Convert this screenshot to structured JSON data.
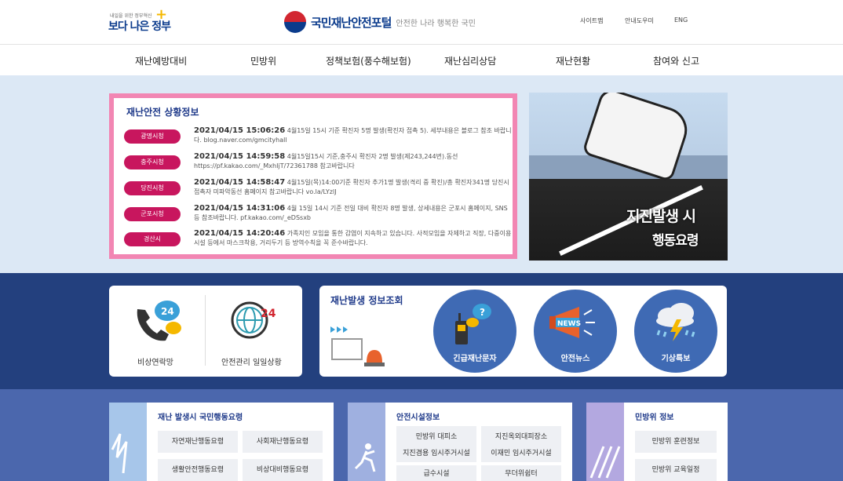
{
  "header": {
    "gov_logo_small": "내일을 위한 정부혁신",
    "gov_logo_big": "보다 나은 정부",
    "portal_name": "국민재난안전포털",
    "portal_slogan": "안전한 나라 행복한 국민",
    "util": [
      "사이트맵",
      "안내도우미",
      "ENG"
    ]
  },
  "gnb": [
    "재난예방대비",
    "민방위",
    "정책보험(풍수해보험)",
    "재난심리상담",
    "재난현황",
    "참여와 신고"
  ],
  "status": {
    "title": "재난안전 상황정보",
    "items": [
      {
        "badge": "광명시청",
        "time": "2021/04/15 15:06:26",
        "text": "4월15일 15시 기준 확진자 5명 발생(확진자 접촉 5). 세부내용은 블로그 참조 바랍니다. blog.naver.com/gmcityhall"
      },
      {
        "badge": "충주시청",
        "time": "2021/04/15 14:59:58",
        "text": "4월15일15시 기준,충주시 확진자 2명 발생(제243,244번).동선 https://pf.kakao.com/_MxhIjT/72361788 참고바랍니다"
      },
      {
        "badge": "당진시청",
        "time": "2021/04/15 14:58:47",
        "text": "4월15일(목)14:00기준 확진자 추가1명 발생(격리 중 확진)/총 확진자341명 당진시 접촉자 미파악동선 홈페이지 참고바랍니다 vo.la/LYzlJ"
      },
      {
        "badge": "군포시청",
        "time": "2021/04/15 14:31:06",
        "text": "4월 15일 14시 기준 전일 대비 확진자 8명 발생, 상세내용은 군포시 홈페이지, SNS 등 참조바랍니다. pf.kakao.com/_eDSsxb"
      },
      {
        "badge": "경산시",
        "time": "2021/04/15 14:20:46",
        "text": "가족지인 모임을 통한 감염이 지속하고 있습니다. 사적모임을 자제하고 직장, 다중이용시설 등에서 마스크착용, 거리두기 등 방역수칙을 꼭 준수바랍니다."
      }
    ]
  },
  "banner": {
    "line1": "지진발생 시",
    "line2": "행동요령"
  },
  "contact": {
    "items": [
      "비상연락망",
      "안전관리 일일상황"
    ],
    "badge_24": "24"
  },
  "info": {
    "title": "재난발생 정보조회",
    "circles": [
      "긴급재난문자",
      "안전뉴스",
      "기상특보"
    ],
    "news_label": "NEWS"
  },
  "cards": [
    {
      "title": "재난 발생시 국민행동요령",
      "pills": [
        "자연재난행동요령",
        "사회재난행동요령",
        "생활안전행동요령",
        "비상대비행동요령"
      ]
    },
    {
      "title": "안전시설정보",
      "pills": [
        "민방위 대피소",
        "지진옥외대피장소",
        "지진겸용 임시주거시설",
        "이재민 임시주거시설",
        "급수시설",
        "무더위쉼터"
      ]
    },
    {
      "title": "민방위 정보",
      "pills": [
        "민방위 훈련정보",
        "민방위 교육일정"
      ]
    }
  ]
}
